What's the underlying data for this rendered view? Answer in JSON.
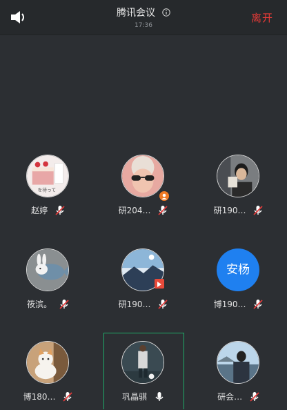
{
  "header": {
    "title": "腾讯会议",
    "time": "17:36",
    "leave_label": "离开"
  },
  "participants": [
    {
      "name": "赵婷",
      "mic": "muted",
      "avatar": "cake-photo"
    },
    {
      "name": "研204…",
      "mic": "muted",
      "avatar": "sunglasses-photo",
      "badge": "host-icon"
    },
    {
      "name": "研190…",
      "mic": "muted",
      "avatar": "person-photo"
    },
    {
      "name": "筱滨。",
      "mic": "muted",
      "avatar": "rabbit-fish-drawing"
    },
    {
      "name": "研190…",
      "mic": "muted",
      "avatar": "landscape-photo",
      "badge": "red-tag-icon"
    },
    {
      "name": "博190…",
      "mic": "muted",
      "avatar_text": "安杨",
      "avatar_color": "#1f80f0"
    },
    {
      "name": "博180…",
      "mic": "muted",
      "avatar": "cat-photo"
    },
    {
      "name": "巩晶骐",
      "mic": "on",
      "avatar": "soccer-photo",
      "speaking": true
    },
    {
      "name": "研会…",
      "mic": "muted",
      "avatar": "coast-photo"
    }
  ],
  "colors": {
    "background": "#2c2f33",
    "header": "#26292c",
    "leave": "#e83a37",
    "speaking_border": "#1fae6a",
    "mic_muted": "#e23b3b"
  }
}
